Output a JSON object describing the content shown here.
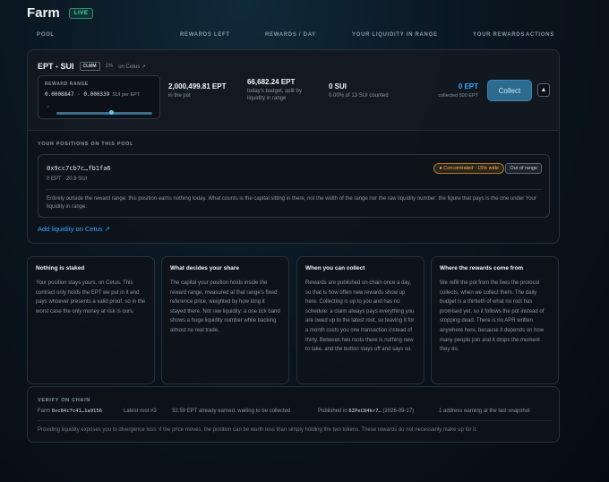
{
  "header": {
    "title": "Farm",
    "live": "LIVE"
  },
  "columns": [
    "POOL",
    "REWARDS LEFT",
    "REWARDS / DAY",
    "YOUR LIQUIDITY IN RANGE",
    "YOUR REWARDS",
    "ACTIONS"
  ],
  "pool": {
    "pair": "EPT - SUI",
    "tag": "CLMM",
    "fee": "1%",
    "cetus_link": "on Cetus ↗",
    "reward_range": {
      "label": "REWARD RANGE",
      "low": "0.0008847",
      "high": "0.000339",
      "unit": "SUI per EPT",
      "hint": "↗",
      "low_fraction": 0.55
    },
    "rewards_left": {
      "value": "2,000,499.81 EPT",
      "sub": "in the pot"
    },
    "rewards_day": {
      "value": "66,682.24 EPT",
      "sub": "today's budget, split by liquidity in range"
    },
    "liquidity": {
      "value": "0 SUI",
      "sub": "0.00% of 13 SUI counted"
    },
    "your_rewards": {
      "value": "0 EPT",
      "sub": "collected 500 EPT"
    },
    "collect_label": "Collect",
    "toggle_icon": "▲"
  },
  "positions": {
    "title": "YOUR POSITIONS ON THIS POOL",
    "items": [
      {
        "id": "0x9cc7cb7c…fb1fa6",
        "balance": "0 EPT · 20.9 SUI",
        "concentrated": "● Concentrated · 15% wide",
        "status": "Out of range",
        "note": "Entirely outside the reward range: this position earns nothing today. What counts is the capital sitting in there, not the width of the range nor the raw liquidity number: the figure that pays is the one under Your liquidity in range."
      }
    ],
    "add_link": "Add liquidity on Cetus ↗"
  },
  "info_cards": [
    {
      "title": "Nothing is staked",
      "body": "Your position stays yours, on Cetus. This contract only holds the EPT we put in it and pays whoever presents a valid proof, so in the worst case the only money at risk is ours."
    },
    {
      "title": "What decides your share",
      "body": "The capital your position holds inside the reward range, measured at that range's fixed reference price, weighted by how long it stayed there. Not raw liquidity: a one tick band shows a huge liquidity number while backing almost no real trade."
    },
    {
      "title": "When you can collect",
      "body": "Rewards are published on chain once a day, so that is how often new rewards show up here. Collecting is up to you and has no schedule: a claim always pays everything you are owed up to the latest root, so leaving it for a month costs you one transaction instead of thirty. Between two roots there is nothing new to take, and the button stays off and says so."
    },
    {
      "title": "Where the rewards come from",
      "body": "We refill the pot from the fees the protocol collects, when we collect them. The daily budget is a thirtieth of what no root has promised yet, so it follows the pot instead of stopping dead. There is no APR written anywhere here, because it depends on how many people join and it drops the moment they do."
    }
  ],
  "verify": {
    "title": "VERIFY ON CHAIN",
    "farm_label": "Farm",
    "farm_addr": "0xc84c7c41…1a9156",
    "latest_root": "Latest root #3",
    "earned": "32.59 EPT already earned, waiting to be collected",
    "published_label": "Published in",
    "published_tx": "6ZPeC84kr7…",
    "published_date": "(2026-09-17)",
    "snapshot": "1 address earning at the last snapshot",
    "note": "Providing liquidity exposes you to divergence loss: if the price moves, the position can be worth less than simply holding the two tokens. These rewards do not necessarily make up for it."
  }
}
